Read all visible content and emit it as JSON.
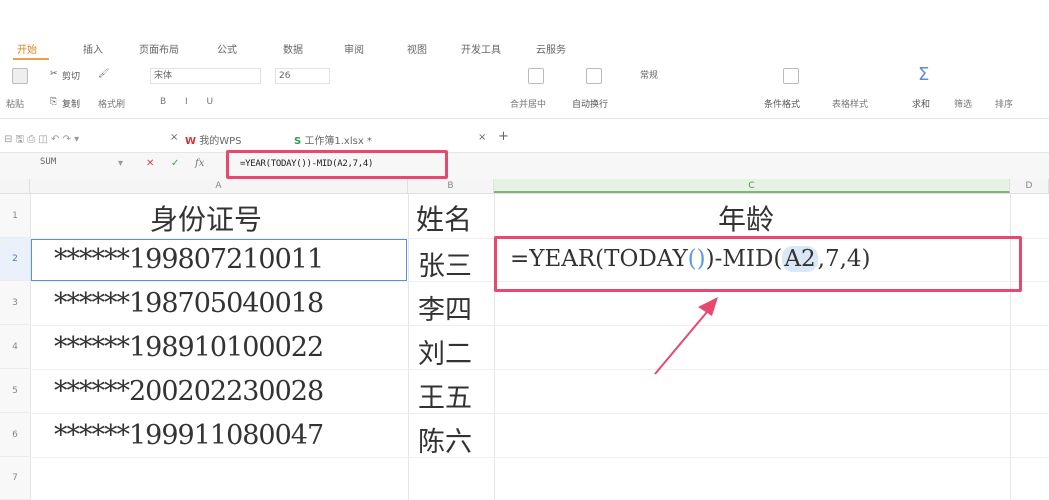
{
  "ribbon_tabs": [
    "开始",
    "插入",
    "页面布局",
    "公式",
    "数据",
    "审阅",
    "视图",
    "开发工具",
    "云服务"
  ],
  "ribbon": {
    "cut": "剪切",
    "copy": "复制",
    "paste": "粘贴",
    "format_painter": "格式刷",
    "font_name": "宋体",
    "font_size": "26",
    "merge_center": "合并居中",
    "wrap_text": "自动换行",
    "number_format": "常规",
    "conditional_format": "条件格式",
    "table_style": "表格样式",
    "sum": "求和",
    "filter": "筛选",
    "sort": "排序"
  },
  "quick_access": {
    "my_wps": "我的WPS",
    "doc_tab": "工作簿1.xlsx *",
    "add_tab": "+"
  },
  "formula_bar": {
    "name_box": "SUM",
    "fx": "fx",
    "formula": "=YEAR(TODAY())-MID(A2,7,4)"
  },
  "columns": [
    "A",
    "B",
    "C",
    "D"
  ],
  "rows": [
    "1",
    "2",
    "3",
    "4",
    "5",
    "6",
    "7"
  ],
  "headers": {
    "id": "身份证号",
    "name": "姓名",
    "age": "年龄"
  },
  "records": [
    {
      "id": "******199807210011",
      "name": "张三"
    },
    {
      "id": "******198705040018",
      "name": "李四"
    },
    {
      "id": "******198910100022",
      "name": "刘二"
    },
    {
      "id": "******200202230028",
      "name": "王五"
    },
    {
      "id": "******199911080047",
      "name": "陈六"
    }
  ],
  "formula_cell": {
    "prefix": "=YEAR(TODAY",
    "inner_parens": "()",
    "mid": ")-MID(",
    "ref": "A2",
    "suffix": ",7,4)"
  },
  "colors": {
    "accent_tab": "#d9821e",
    "highlight": "#e8476e",
    "selection": "#5b8fd8"
  }
}
